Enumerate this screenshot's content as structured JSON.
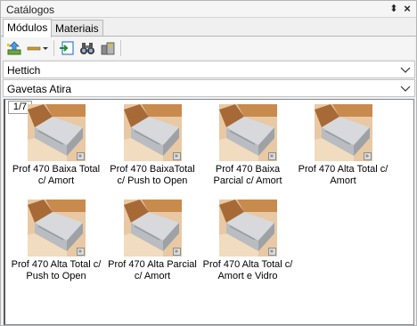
{
  "window": {
    "title": "Catálogos",
    "pin_glyph": "⬍",
    "close_glyph": "×"
  },
  "tabs": [
    {
      "label": "Módulos",
      "active": true
    },
    {
      "label": "Materiais",
      "active": false
    }
  ],
  "toolbar": {
    "buttons": [
      {
        "icon": "import-up-icon"
      },
      {
        "icon": "line-dropdown-icon"
      },
      {
        "icon": "insert-icon"
      },
      {
        "icon": "binoculars-icon"
      },
      {
        "icon": "database-icon"
      }
    ]
  },
  "filters": {
    "manufacturer": "Hettich",
    "category": "Gavetas Atira"
  },
  "pager": "1/7",
  "items": [
    {
      "label": "Prof 470 Baixa Total c/ Amort"
    },
    {
      "label": "Prof 470 BaixaTotal c/ Push to Open"
    },
    {
      "label": "Prof 470 Baixa Parcial c/ Amort"
    },
    {
      "label": "Prof 470 Alta Total c/ Amort"
    },
    {
      "label": "Prof 470 Alta Total c/ Push to Open"
    },
    {
      "label": "Prof 470 Alta Parcial c/ Amort"
    },
    {
      "label": "Prof 470 Alta Total c/ Amort e Vidro"
    }
  ],
  "colors": {
    "wood": "#c98a4e",
    "wall": "#e8c9a4",
    "drawer": "#b9bcc0"
  }
}
